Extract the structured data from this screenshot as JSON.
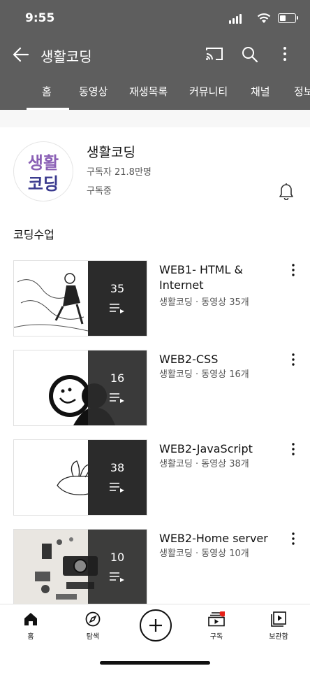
{
  "status_bar": {
    "time": "9:55"
  },
  "app_bar": {
    "title": "생활코딩"
  },
  "tabs": [
    "홈",
    "동영상",
    "재생목록",
    "커뮤니티",
    "채널",
    "정보"
  ],
  "channel": {
    "name": "생활코딩",
    "subscribers": "구독자 21.8만명",
    "subscribe_state": "구독중",
    "avatar_text": [
      "생활",
      "코딩"
    ]
  },
  "section": {
    "title": "코딩수업"
  },
  "playlists": [
    {
      "title": "WEB1- HTML & Internet",
      "meta": "생활코딩 · 동영상 35개",
      "count": "35"
    },
    {
      "title": "WEB2-CSS",
      "meta": "생활코딩 · 동영상 16개",
      "count": "16"
    },
    {
      "title": "WEB2-JavaScript",
      "meta": "생활코딩 · 동영상 38개",
      "count": "38"
    },
    {
      "title": "WEB2-Home server",
      "meta": "생활코딩 · 동영상 10개",
      "count": "10"
    }
  ],
  "bottom_nav": [
    {
      "label": "홈",
      "icon": "home-icon"
    },
    {
      "label": "탐색",
      "icon": "compass-icon"
    },
    {
      "label": "",
      "icon": "create-icon"
    },
    {
      "label": "구독",
      "icon": "subscriptions-icon"
    },
    {
      "label": "보관함",
      "icon": "library-icon"
    }
  ],
  "colors": {
    "app_bar": "#5e5e5e",
    "overlay": "#2b2b2b",
    "notification_dot": "#e62117"
  }
}
